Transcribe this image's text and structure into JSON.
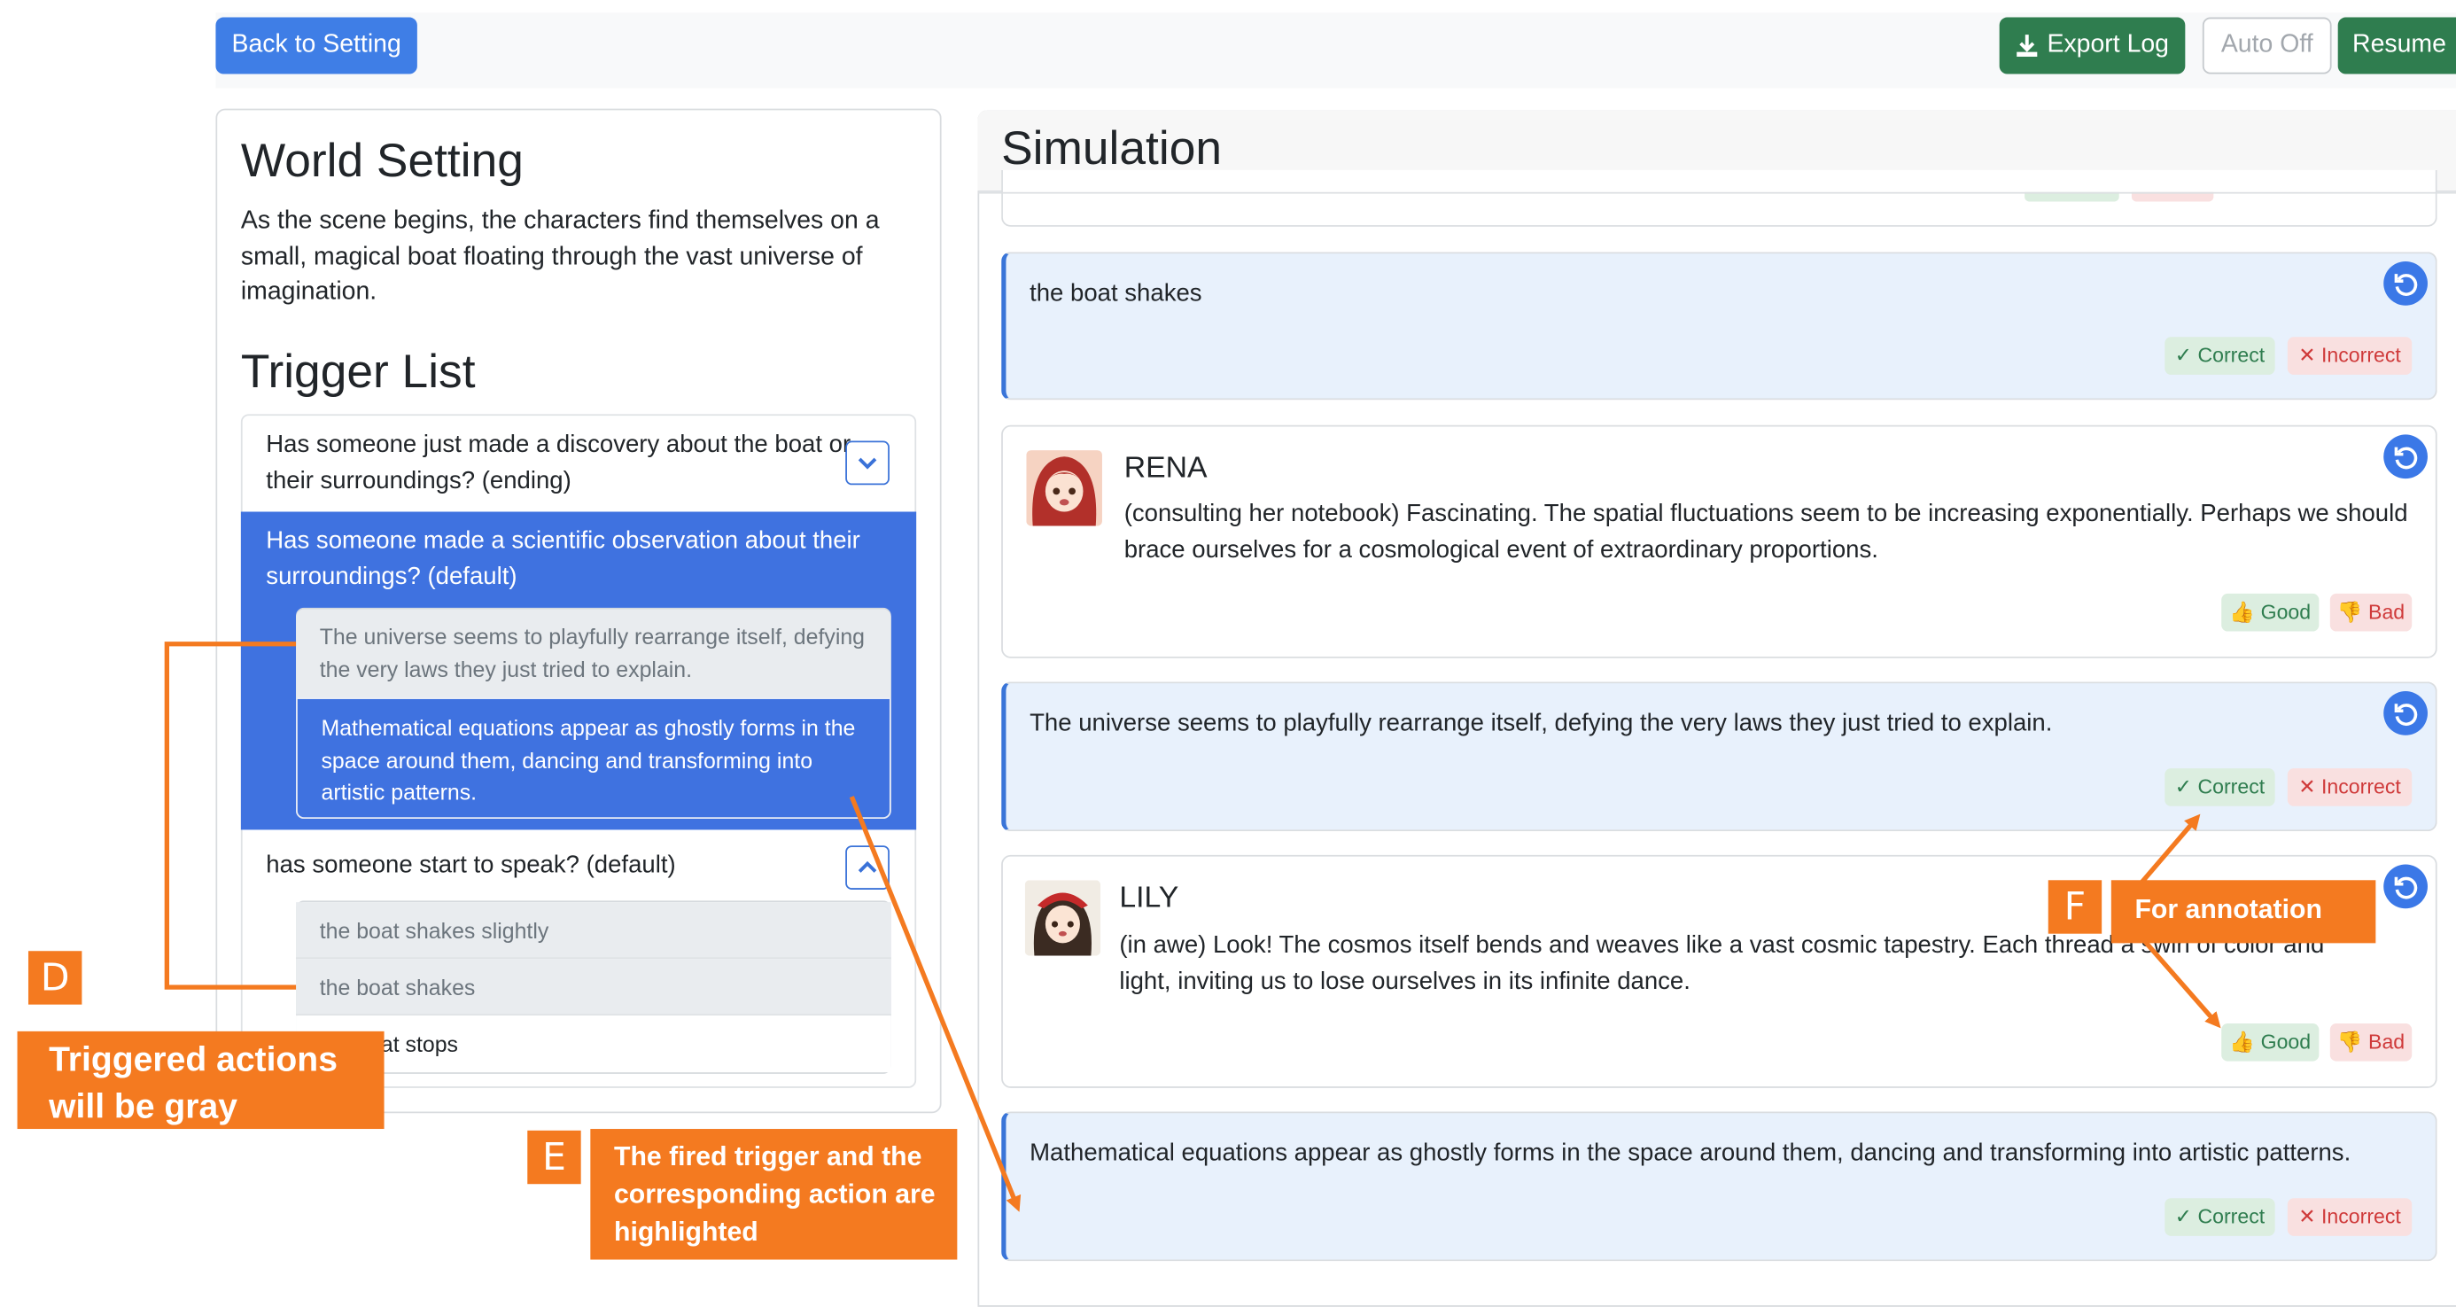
{
  "topbar": {
    "back_label": "Back to Setting",
    "export_label": "Export Log",
    "auto_label": "Auto Off",
    "resume_label": "Resume"
  },
  "world": {
    "title": "World Setting",
    "description": "As the scene begins, the characters find themselves on a small, magical boat floating through the vast universe of imagination."
  },
  "triggers": {
    "title": "Trigger List",
    "items": [
      {
        "text": "Has someone just made a discovery about the boat or their surroundings? (ending)"
      },
      {
        "text": "Has someone made a scientific observation about their surroundings? (default)",
        "actions": [
          "The universe seems to playfully rearrange itself, defying the very laws they just tried to explain.",
          "Mathematical equations appear as ghostly forms in the space around them, dancing and transforming into artistic patterns."
        ]
      },
      {
        "text": "has someone start to speak? (default)",
        "actions": [
          "the boat shakes slightly",
          "the boat shakes",
          "the boat stops"
        ]
      }
    ]
  },
  "simulation": {
    "title": "Simulation",
    "cards": [
      {
        "text": "the boat shakes",
        "correct": "✓ Correct",
        "incorrect": "✕ Incorrect"
      },
      {
        "speaker": "RENA",
        "text": "(consulting her notebook) Fascinating. The spatial fluctuations seem to be increasing exponentially. Perhaps we should brace ourselves for a cosmological event of extraordinary proportions.",
        "good": "👍 Good",
        "bad": "👎 Bad"
      },
      {
        "text": "The universe seems to playfully rearrange itself, defying the very laws they just tried to explain.",
        "correct": "✓ Correct",
        "incorrect": "✕ Incorrect"
      },
      {
        "speaker": "LILY",
        "text": "(in awe) Look! The cosmos itself bends and weaves like a vast cosmic tapestry. Each thread a swirl of color and light, inviting us to lose ourselves in its infinite dance.",
        "good": "👍 Good",
        "bad": "👎 Bad"
      },
      {
        "text": "Mathematical equations appear as ghostly forms in the space around them, dancing and transforming into artistic patterns.",
        "correct": "✓ Correct",
        "incorrect": "✕ Incorrect"
      }
    ]
  },
  "annotations": {
    "d_letter": "D",
    "d_text": "Triggered actions will be gray",
    "e_letter": "E",
    "e_text": "The fired trigger and the corresponding action are highlighted",
    "f_letter": "F",
    "f_text": "For annotation"
  },
  "colors": {
    "primary": "#3f7ee6",
    "success": "#2f7d4f",
    "highlight": "#3f72e0",
    "annotation": "#f47a20",
    "env_card": "#e8f1fc"
  }
}
